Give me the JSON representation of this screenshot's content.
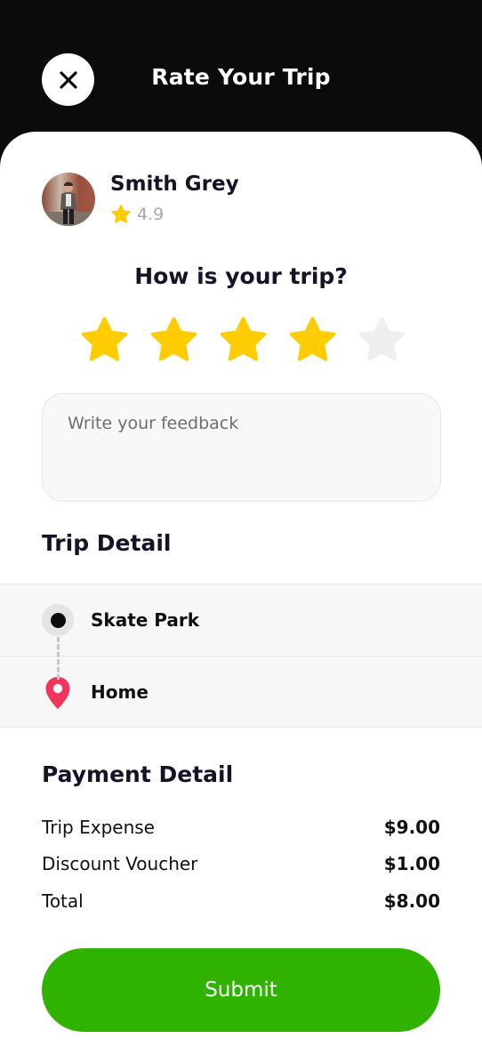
{
  "header": {
    "title": "Rate Your Trip",
    "close_icon": "close-icon",
    "background": "#0b0b0b"
  },
  "driver": {
    "name": "Smith Grey",
    "rating": "4.9",
    "avatar_icon": "avatar"
  },
  "rating_prompt": {
    "question": "How is your trip?",
    "selected_stars": 4,
    "max_stars": 5,
    "star_color_active": "#ffcc00",
    "star_color_inactive": "#efefef"
  },
  "feedback": {
    "placeholder": "Write your feedback",
    "value": ""
  },
  "trip_detail": {
    "title": "Trip Detail",
    "stops": [
      {
        "label": "Skate Park",
        "icon": "origin-dot-icon"
      },
      {
        "label": "Home",
        "icon": "location-pin-icon"
      }
    ]
  },
  "payment_detail": {
    "title": "Payment Detail",
    "rows": [
      {
        "label": "Trip Expense",
        "amount": "$9.00"
      },
      {
        "label": "Discount Voucher",
        "amount": "$1.00"
      },
      {
        "label": "Total",
        "amount": "$8.00"
      }
    ]
  },
  "submit": {
    "label": "Submit",
    "color": "#2fb200"
  }
}
